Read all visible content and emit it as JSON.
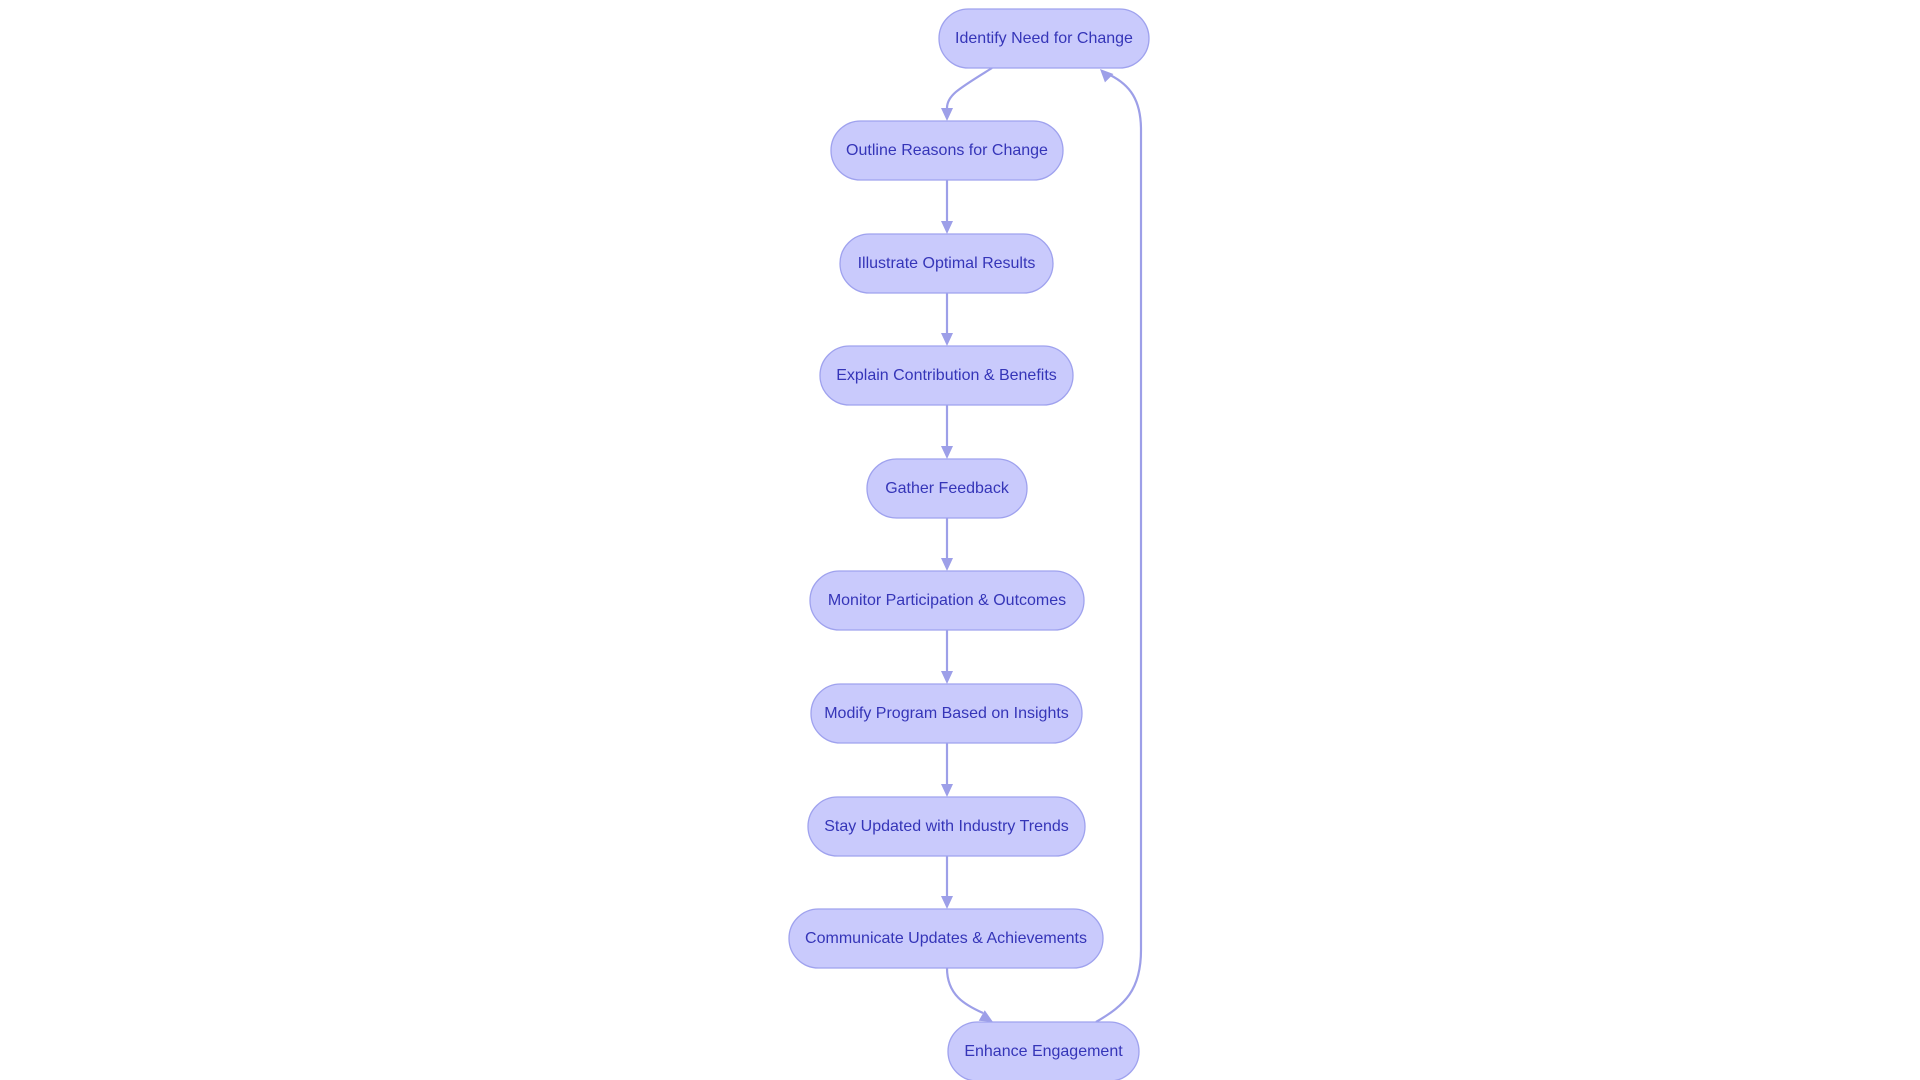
{
  "diagram": {
    "type": "flowchart",
    "direction": "top-down",
    "colors": {
      "node_fill": "#c9cafc",
      "node_stroke": "#9fa2ee",
      "text": "#3535b8",
      "edge": "#9d9fe8"
    },
    "nodes": [
      {
        "id": "A",
        "label": "Identify Need for Change"
      },
      {
        "id": "B",
        "label": "Outline Reasons for Change"
      },
      {
        "id": "C",
        "label": "Illustrate Optimal Results"
      },
      {
        "id": "D",
        "label": "Explain Contribution & Benefits"
      },
      {
        "id": "E",
        "label": "Gather Feedback"
      },
      {
        "id": "F",
        "label": "Monitor Participation & Outcomes"
      },
      {
        "id": "G",
        "label": "Modify Program Based on Insights"
      },
      {
        "id": "H",
        "label": "Stay Updated with Industry Trends"
      },
      {
        "id": "I",
        "label": "Communicate Updates & Achievements"
      },
      {
        "id": "J",
        "label": "Enhance Engagement"
      }
    ],
    "edges": [
      [
        "A",
        "B"
      ],
      [
        "B",
        "C"
      ],
      [
        "C",
        "D"
      ],
      [
        "D",
        "E"
      ],
      [
        "E",
        "F"
      ],
      [
        "F",
        "G"
      ],
      [
        "G",
        "H"
      ],
      [
        "H",
        "I"
      ],
      [
        "I",
        "J"
      ],
      [
        "J",
        "A"
      ]
    ]
  }
}
